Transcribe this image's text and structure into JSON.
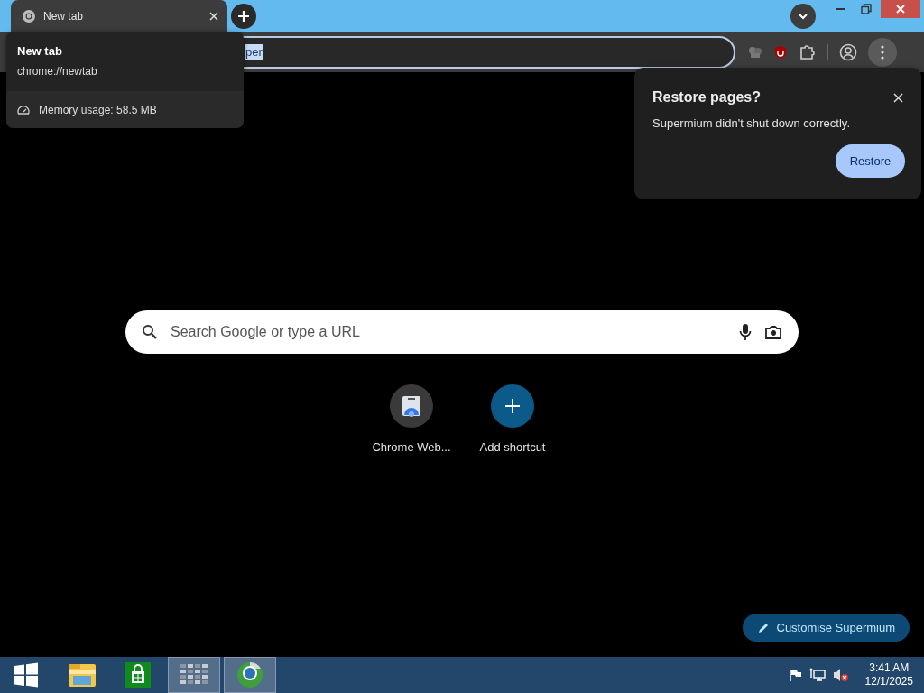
{
  "tab": {
    "title": "New tab"
  },
  "omnibox": {
    "value": "per"
  },
  "tab_tooltip": {
    "title": "New tab",
    "url": "chrome://newtab",
    "memory": "Memory usage: 58.5 MB"
  },
  "restore_bubble": {
    "title": "Restore pages?",
    "message": "Supermium didn't shut down correctly.",
    "button": "Restore"
  },
  "search": {
    "placeholder": "Search Google or type a URL"
  },
  "shortcuts": [
    {
      "kind": "site",
      "label": "Chrome Web..."
    },
    {
      "kind": "add",
      "label": "Add shortcut"
    }
  ],
  "customise_button": "Customise Supermium",
  "taskbar": {
    "apps": [
      {
        "kind": "start",
        "running": false
      },
      {
        "kind": "explorer",
        "running": false
      },
      {
        "kind": "store",
        "running": false
      },
      {
        "kind": "blocks",
        "running": true
      },
      {
        "kind": "browser",
        "running": true
      }
    ],
    "time": "3:41 AM",
    "date": "12/1/2025"
  }
}
